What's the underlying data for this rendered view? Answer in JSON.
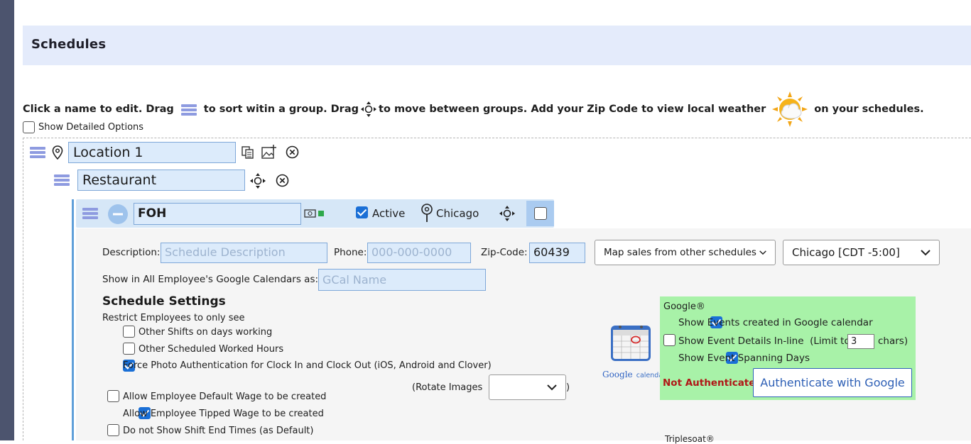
{
  "header": {
    "title": "Schedules"
  },
  "intro": {
    "part1": "Click a name to edit. Drag",
    "part2": "to sort witin a group. Drag",
    "part3": "to move between groups. Add your Zip Code to view local weather",
    "part4": "on your schedules."
  },
  "detailed_options": {
    "label": "Show Detailed Options",
    "checked": false
  },
  "location": {
    "name": "Location 1"
  },
  "group": {
    "name": "Restaurant"
  },
  "schedule": {
    "name": "FOH",
    "active_label": "Active",
    "active": true,
    "city": "Chicago"
  },
  "details": {
    "description_label": "Description:",
    "description_placeholder": "Schedule Description",
    "phone_label": "Phone:",
    "phone_placeholder": "000-000-0000",
    "zip_label": "Zip-Code:",
    "zip_value": "60439",
    "map_sales_select": "Map sales from other schedules",
    "timezone_select": "Chicago [CDT -5:00]",
    "gcal_label": "Show in All Employee's Google Calendars as:",
    "gcal_placeholder": "GCal Name"
  },
  "settings": {
    "title": "Schedule Settings",
    "restrict_label": "Restrict Employees to only see",
    "options": [
      {
        "label": "Other Shifts on days working",
        "checked": false
      },
      {
        "label": "Other Scheduled Worked Hours",
        "checked": false
      },
      {
        "label": "Force Photo Authentication for Clock In and Clock Out (iOS, Android and Clover)",
        "checked": true
      },
      {
        "label": "Allow Employee Default Wage to be created",
        "checked": false
      },
      {
        "label": "Allow Employee Tipped Wage to be created",
        "checked": true
      },
      {
        "label": "Do not Show Shift End Times (as Default)",
        "checked": false
      }
    ],
    "rotate_label": "(Rotate Images",
    "rotate_close": ")",
    "rotate_value": ""
  },
  "google": {
    "logo_text_1": "Google",
    "logo_text_2": "calendar",
    "title": "Google®",
    "opt1": "Show Events created in Google calendar",
    "opt1_checked": true,
    "opt2": "Show Event Details In-line  (Limit to",
    "opt2_checked": false,
    "opt2_value": "3",
    "opt2_suffix": "chars)",
    "opt3": "Show Event Spanning Days",
    "opt3_checked": true,
    "status": "Not Authenticated",
    "status_color": "#b01818",
    "auth_button": "Authenticate with Google"
  },
  "footer": {
    "partial": "Triplesoat®"
  },
  "colors": {
    "accent": "#1a6fd6",
    "header_bg": "#e4ebfb",
    "google_bg": "#a8f2a8",
    "sidebar": "#4c546e"
  }
}
